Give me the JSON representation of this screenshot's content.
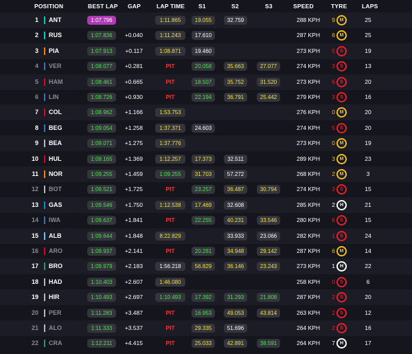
{
  "headers": {
    "position": "POSITION",
    "best_lap": "BEST LAP",
    "gap": "GAP",
    "lap_time": "LAP TIME",
    "s1": "S1",
    "s2": "S2",
    "s3": "S3",
    "speed": "SPEED",
    "tyre": "TYRE",
    "laps": "LAPS"
  },
  "colors": {
    "fastest": "#b03ab3",
    "personal_best": "#4ee04e",
    "normal": "#f0e040",
    "pit": "#ff3030"
  },
  "rows": [
    {
      "pos": "1",
      "team_color": "#00d2be",
      "driver": "ANT",
      "out": false,
      "best": "1:07.796",
      "best_fastest": true,
      "gap": "",
      "lap": "1:11.865",
      "lap_color": "yellow",
      "pit": false,
      "s1": "19.055",
      "s1c": "y",
      "s2": "32.759",
      "s2c": "w",
      "s3": "",
      "s3c": "w",
      "speed": "288 KPH",
      "tyre_age": "9",
      "tyre": "M",
      "laps": "25"
    },
    {
      "pos": "2",
      "team_color": "#00d2be",
      "driver": "RUS",
      "out": false,
      "best": "1:07.836",
      "best_fastest": false,
      "gap": "+0.040",
      "lap": "1:11.243",
      "lap_color": "yellow",
      "pit": false,
      "s1": "17.610",
      "s1c": "w",
      "s2": "",
      "s2c": "w",
      "s3": "",
      "s3c": "w",
      "speed": "287 KPH",
      "tyre_age": "6",
      "tyre": "M",
      "laps": "25"
    },
    {
      "pos": "3",
      "team_color": "#ff8000",
      "driver": "PIA",
      "out": false,
      "best": "1:07.913",
      "best_fastest": false,
      "gap": "+0.117",
      "lap": "1:08.871",
      "lap_color": "yellow",
      "pit": false,
      "s1": "19.460",
      "s1c": "w",
      "s2": "",
      "s2c": "w",
      "s3": "",
      "s3c": "w",
      "speed": "273 KPH",
      "tyre_age": "5",
      "tyre": "S",
      "laps": "19"
    },
    {
      "pos": "4",
      "team_color": "#3671c6",
      "driver": "VER",
      "out": true,
      "best": "1:08.077",
      "best_fastest": false,
      "gap": "+0.281",
      "lap": "",
      "lap_color": "",
      "pit": true,
      "s1": "20.058",
      "s1c": "g",
      "s2": "35.663",
      "s2c": "y",
      "s3": "27.077",
      "s3c": "y",
      "speed": "274 KPH",
      "tyre_age": "3",
      "tyre": "S",
      "laps": "13"
    },
    {
      "pos": "5",
      "team_color": "#e8002d",
      "driver": "HAM",
      "out": true,
      "best": "1:08.461",
      "best_fastest": false,
      "gap": "+0.665",
      "lap": "",
      "lap_color": "",
      "pit": true,
      "s1": "18.507",
      "s1c": "g",
      "s2": "35.752",
      "s2c": "y",
      "s3": "31.520",
      "s3c": "y",
      "speed": "273 KPH",
      "tyre_age": "6",
      "tyre": "S",
      "laps": "20"
    },
    {
      "pos": "6",
      "team_color": "#3671c6",
      "driver": "LIN",
      "out": true,
      "best": "1:08.726",
      "best_fastest": false,
      "gap": "+0.930",
      "lap": "",
      "lap_color": "",
      "pit": true,
      "s1": "22.194",
      "s1c": "g",
      "s2": "36.791",
      "s2c": "y",
      "s3": "25.442",
      "s3c": "y",
      "speed": "279 KPH",
      "tyre_age": "3",
      "tyre": "S",
      "laps": "16"
    },
    {
      "pos": "7",
      "team_color": "#e8002d",
      "driver": "COL",
      "out": false,
      "best": "1:08.962",
      "best_fastest": false,
      "gap": "+1.166",
      "lap": "1:53.753",
      "lap_color": "yellow",
      "pit": false,
      "s1": "",
      "s1c": "w",
      "s2": "",
      "s2c": "w",
      "s3": "",
      "s3c": "w",
      "speed": "276 KPH",
      "tyre_age": "0",
      "tyre": "M",
      "laps": "20"
    },
    {
      "pos": "8",
      "team_color": "#3671c6",
      "driver": "BEG",
      "out": false,
      "best": "1:09.054",
      "best_fastest": false,
      "gap": "+1.258",
      "lap": "1:37.371",
      "lap_color": "yellow",
      "pit": false,
      "s1": "24.603",
      "s1c": "w",
      "s2": "",
      "s2c": "w",
      "s3": "",
      "s3c": "w",
      "speed": "274 KPH",
      "tyre_age": "5",
      "tyre": "S",
      "laps": "20"
    },
    {
      "pos": "9",
      "team_color": "#b6babd",
      "driver": "BEA",
      "out": false,
      "best": "1:09.071",
      "best_fastest": false,
      "gap": "+1.275",
      "lap": "1:37.776",
      "lap_color": "yellow",
      "pit": false,
      "s1": "",
      "s1c": "w",
      "s2": "",
      "s2c": "w",
      "s3": "",
      "s3c": "w",
      "speed": "273 KPH",
      "tyre_age": "0",
      "tyre": "M",
      "laps": "19"
    },
    {
      "pos": "10",
      "team_color": "#e8002d",
      "driver": "HUL",
      "out": false,
      "best": "1:09.165",
      "best_fastest": false,
      "gap": "+1.369",
      "lap": "1:12.257",
      "lap_color": "yellow",
      "pit": false,
      "s1": "17.373",
      "s1c": "y",
      "s2": "32.511",
      "s2c": "w",
      "s3": "",
      "s3c": "w",
      "speed": "289 KPH",
      "tyre_age": "3",
      "tyre": "M",
      "laps": "23"
    },
    {
      "pos": "11",
      "team_color": "#ff8000",
      "driver": "NOR",
      "out": false,
      "best": "1:09.255",
      "best_fastest": false,
      "gap": "+1.459",
      "lap": "1:09.255",
      "lap_color": "green",
      "pit": false,
      "s1": "31.703",
      "s1c": "y",
      "s2": "57.272",
      "s2c": "w",
      "s3": "",
      "s3c": "w",
      "speed": "268 KPH",
      "tyre_age": "2",
      "tyre": "M",
      "laps": "3"
    },
    {
      "pos": "12",
      "team_color": "#b6babd",
      "driver": "BOT",
      "out": true,
      "best": "1:09.521",
      "best_fastest": false,
      "gap": "+1.725",
      "lap": "",
      "lap_color": "",
      "pit": true,
      "s1": "23.257",
      "s1c": "g",
      "s2": "36.487",
      "s2c": "y",
      "s3": "30.794",
      "s3c": "y",
      "speed": "274 KPH",
      "tyre_age": "3",
      "tyre": "S",
      "laps": "15"
    },
    {
      "pos": "13",
      "team_color": "#0093cc",
      "driver": "GAS",
      "out": false,
      "best": "1:09.546",
      "best_fastest": false,
      "gap": "+1.750",
      "lap": "1:12.538",
      "lap_color": "yellow",
      "pit": false,
      "s1": "17.469",
      "s1c": "y",
      "s2": "32.608",
      "s2c": "w",
      "s3": "",
      "s3c": "w",
      "speed": "285 KPH",
      "tyre_age": "2",
      "tyre": "H",
      "laps": "21"
    },
    {
      "pos": "14",
      "team_color": "#3671c6",
      "driver": "IWA",
      "out": true,
      "best": "1:09.637",
      "best_fastest": false,
      "gap": "+1.841",
      "lap": "",
      "lap_color": "",
      "pit": true,
      "s1": "22.255",
      "s1c": "g",
      "s2": "40.231",
      "s2c": "y",
      "s3": "33.546",
      "s3c": "y",
      "speed": "280 KPH",
      "tyre_age": "6",
      "tyre": "S",
      "laps": "15"
    },
    {
      "pos": "15",
      "team_color": "#64c4ff",
      "driver": "ALB",
      "out": false,
      "best": "1:09.644",
      "best_fastest": false,
      "gap": "+1.848",
      "lap": "8:22.829",
      "lap_color": "yellow",
      "pit": false,
      "s1": "",
      "s1c": "w",
      "s2": "33.933",
      "s2c": "w",
      "s3": "23.066",
      "s3c": "w",
      "speed": "282 KPH",
      "tyre_age": "1",
      "tyre": "S",
      "laps": "24"
    },
    {
      "pos": "16",
      "team_color": "#e8002d",
      "driver": "ARO",
      "out": true,
      "best": "1:09.937",
      "best_fastest": false,
      "gap": "+2.141",
      "lap": "",
      "lap_color": "",
      "pit": true,
      "s1": "20.281",
      "s1c": "g",
      "s2": "34.948",
      "s2c": "y",
      "s3": "29.142",
      "s3c": "y",
      "speed": "287 KPH",
      "tyre_age": "6",
      "tyre": "M",
      "laps": "14"
    },
    {
      "pos": "17",
      "team_color": "#229971",
      "driver": "BRO",
      "out": false,
      "best": "1:09.979",
      "best_fastest": false,
      "gap": "+2.183",
      "lap": "1:56.218",
      "lap_color": "white",
      "pit": false,
      "s1": "56.829",
      "s1c": "y",
      "s2": "36.146",
      "s2c": "y",
      "s3": "23.243",
      "s3c": "y",
      "speed": "273 KPH",
      "tyre_age": "1",
      "tyre": "H",
      "laps": "22"
    },
    {
      "pos": "18",
      "team_color": "#b6babd",
      "driver": "HAD",
      "out": false,
      "best": "1:10.403",
      "best_fastest": false,
      "gap": "+2.607",
      "lap": "1:46.080",
      "lap_color": "yellow",
      "pit": false,
      "s1": "",
      "s1c": "w",
      "s2": "",
      "s2c": "w",
      "s3": "",
      "s3c": "w",
      "speed": "258 KPH",
      "tyre_age": "0",
      "tyre": "S",
      "laps": "6"
    },
    {
      "pos": "19",
      "team_color": "#b6babd",
      "driver": "HIR",
      "out": false,
      "best": "1:10.493",
      "best_fastest": false,
      "gap": "+2.697",
      "lap": "1:10.493",
      "lap_color": "green",
      "pit": false,
      "s1": "17.392",
      "s1c": "g",
      "s2": "31.293",
      "s2c": "g",
      "s3": "21.808",
      "s3c": "g",
      "speed": "287 KPH",
      "tyre_age": "2",
      "tyre": "S",
      "laps": "20"
    },
    {
      "pos": "20",
      "team_color": "#b6babd",
      "driver": "PER",
      "out": true,
      "best": "1:11.283",
      "best_fastest": false,
      "gap": "+3.487",
      "lap": "",
      "lap_color": "",
      "pit": true,
      "s1": "16.953",
      "s1c": "g",
      "s2": "49.053",
      "s2c": "y",
      "s3": "43.814",
      "s3c": "y",
      "speed": "263 KPH",
      "tyre_age": "2",
      "tyre": "S",
      "laps": "12"
    },
    {
      "pos": "21",
      "team_color": "#b6babd",
      "driver": "ALO",
      "out": true,
      "best": "1:11.333",
      "best_fastest": false,
      "gap": "+3.537",
      "lap": "",
      "lap_color": "",
      "pit": true,
      "s1": "29.335",
      "s1c": "y",
      "s2": "51.696",
      "s2c": "w",
      "s3": "",
      "s3c": "w",
      "speed": "264 KPH",
      "tyre_age": "2",
      "tyre": "S",
      "laps": "16"
    },
    {
      "pos": "22",
      "team_color": "#229971",
      "driver": "CRA",
      "out": true,
      "best": "1:12.211",
      "best_fastest": false,
      "gap": "+4.415",
      "lap": "",
      "lap_color": "",
      "pit": true,
      "s1": "25.033",
      "s1c": "y",
      "s2": "42.891",
      "s2c": "y",
      "s3": "38.591",
      "s3c": "g",
      "speed": "264 KPH",
      "tyre_age": "7",
      "tyre": "H",
      "laps": "17"
    }
  ]
}
